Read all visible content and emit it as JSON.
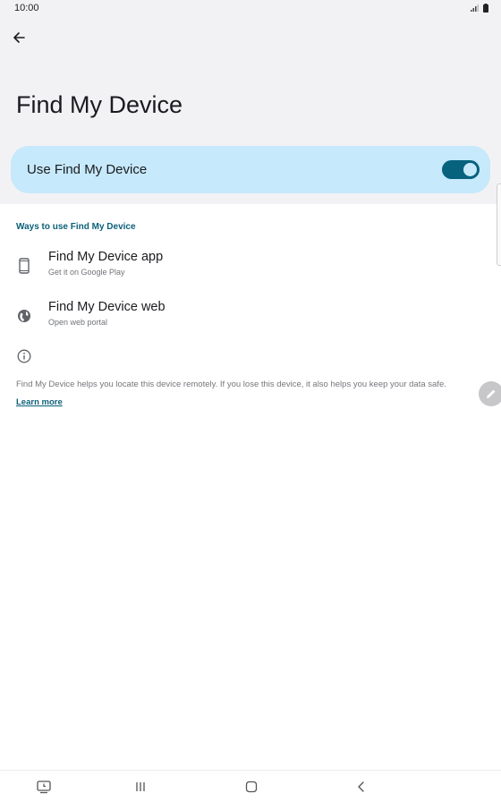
{
  "status_bar": {
    "time": "10:00",
    "signal_icon": "signal-icon",
    "battery_icon": "battery-icon"
  },
  "header": {
    "back_icon": "arrow-back-icon",
    "title": "Find My Device"
  },
  "main_toggle": {
    "label": "Use Find My Device",
    "enabled": true
  },
  "section": {
    "header": "Ways to use Find My Device",
    "items": [
      {
        "title": "Find My Device app",
        "subtitle": "Get it on Google Play",
        "icon": "phone-icon"
      },
      {
        "title": "Find My Device web",
        "subtitle": "Open web portal",
        "icon": "globe-icon"
      }
    ]
  },
  "info": {
    "icon": "info-icon",
    "text": "Find My Device helps you locate this device remotely. If you lose this device, it also helps you keep your data safe.",
    "link": "Learn more"
  },
  "fab": {
    "icon": "edit-pencil-icon"
  },
  "nav_bar": {
    "buttons": [
      "screen-recorder-icon",
      "recent-apps-icon",
      "home-icon",
      "back-icon"
    ]
  },
  "colors": {
    "accent": "#07627e",
    "toggle_card_bg": "#c6e9fb",
    "top_area_bg": "#f2f2f4",
    "link": "#0b5f78"
  }
}
